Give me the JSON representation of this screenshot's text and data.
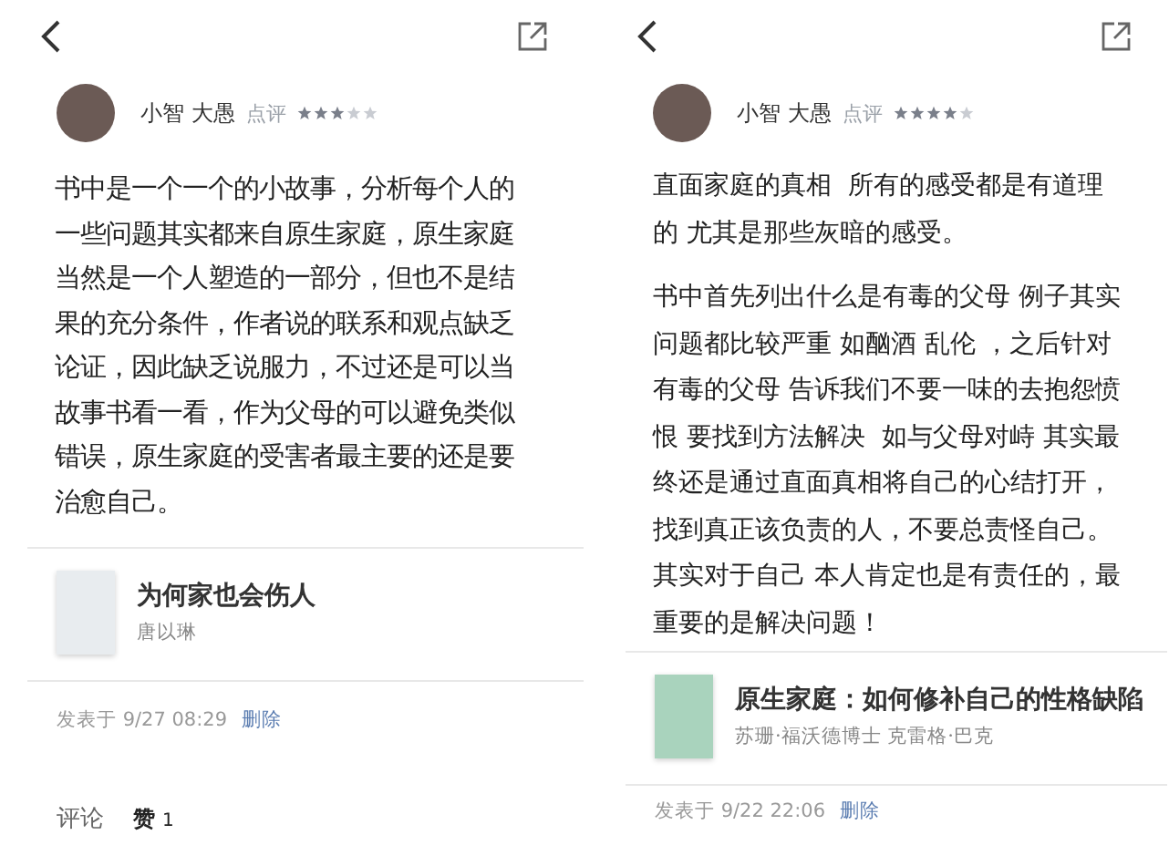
{
  "panels": [
    {
      "user": {
        "name": "小智 大愚",
        "action": "点评",
        "stars": 3
      },
      "paragraphs": [
        "书中是一个一个的小故事，分析每个人的一些问题其实都来自原生家庭，原生家庭当然是一个人塑造的一部分，但也不是结果的充分条件，作者说的联系和观点缺乏论证，因此缺乏说服力，不过还是可以当故事书看一看，作为父母的可以避免类似错误，原生家庭的受害者最主要的还是要治愈自己。"
      ],
      "book": {
        "title": "为何家也会伤人",
        "author": "唐以琳",
        "color": "#e8ecef"
      },
      "meta": {
        "posted": "发表于 9/27 08:29",
        "delete": "删除"
      },
      "footer": {
        "comments": "评论",
        "likes_label": "赞",
        "likes_count": "1"
      }
    },
    {
      "user": {
        "name": "小智 大愚",
        "action": "点评",
        "stars": 4
      },
      "paragraphs": [
        "直面家庭的真相  所有的感受都是有道理的 尤其是那些灰暗的感受。",
        "书中首先列出什么是有毒的父母 例子其实问题都比较严重 如酗酒 乱伦 ，之后针对有毒的父母 告诉我们不要一味的去抱怨愤恨 要找到方法解决  如与父母对峙 其实最终还是通过直面真相将自己的心结打开，找到真正该负责的人，不要总责怪自己。其实对于自己 本人肯定也是有责任的，最重要的是解决问题！"
      ],
      "book": {
        "title": "原生家庭：如何修补自己的性格缺陷",
        "author": "苏珊·福沃德博士 克雷格·巴克",
        "color": "#a9d3bd"
      },
      "meta": {
        "posted": "发表于 9/22 22:06",
        "delete": "删除"
      }
    }
  ]
}
